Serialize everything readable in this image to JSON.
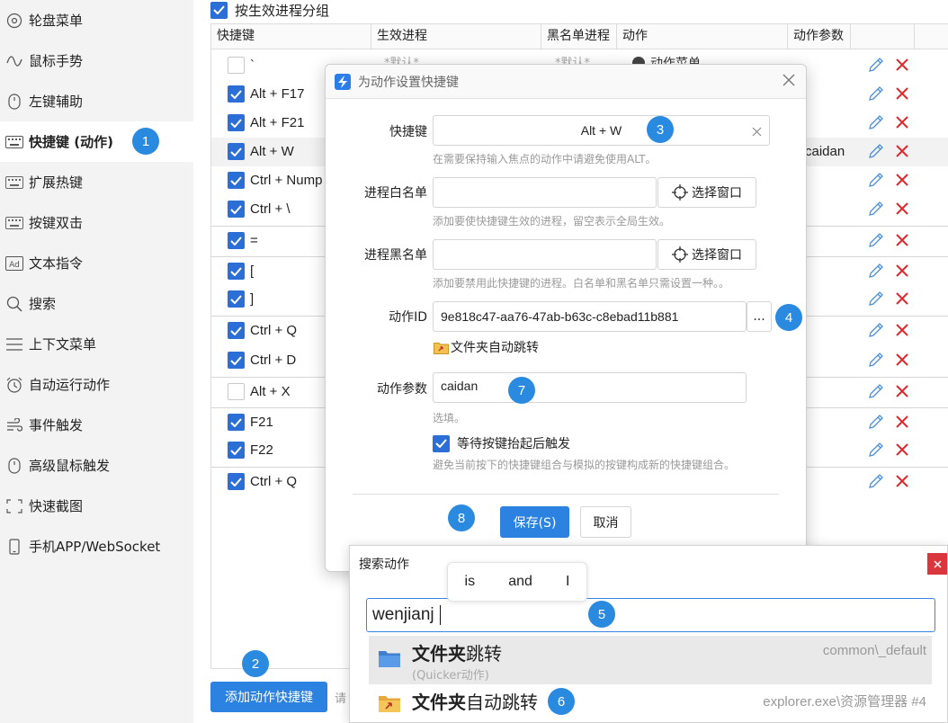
{
  "sidebar": {
    "items": [
      {
        "label": "轮盘菜单",
        "icon": "wheel-icon"
      },
      {
        "label": "鼠标手势",
        "icon": "gesture-icon"
      },
      {
        "label": "左键辅助",
        "icon": "mouse-icon"
      },
      {
        "label": "快捷键 (动作)",
        "icon": "keyboard-icon",
        "active": true
      },
      {
        "label": "扩展热键",
        "icon": "keyboard-icon"
      },
      {
        "label": "按键双击",
        "icon": "keyboard-icon"
      },
      {
        "label": "文本指令",
        "icon": "ad-icon"
      },
      {
        "label": "搜索",
        "icon": "search-icon"
      },
      {
        "label": "上下文菜单",
        "icon": "menu-icon"
      },
      {
        "label": "自动运行动作",
        "icon": "alarm-icon"
      },
      {
        "label": "事件触发",
        "icon": "wind-icon"
      },
      {
        "label": "高级鼠标触发",
        "icon": "mouse-icon"
      },
      {
        "label": "快速截图",
        "icon": "screenshot-icon"
      },
      {
        "label": "手机APP/WebSocket",
        "icon": "phone-icon"
      }
    ]
  },
  "main": {
    "group_by_label": "按生效进程分组",
    "columns": [
      "快捷键",
      "生效进程",
      "黑名单进程",
      "动作",
      "动作参数"
    ],
    "rows": [
      {
        "key": "`",
        "checked": false,
        "process": "*默认*",
        "blacklist": "*默认*",
        "action": "动作菜单"
      },
      {
        "key": "Alt + F17",
        "checked": true
      },
      {
        "key": "Alt + F21",
        "checked": true
      },
      {
        "key": "Alt + W",
        "checked": true,
        "params": "caidan",
        "selected": true
      },
      {
        "key": "Ctrl + Nump",
        "checked": true
      },
      {
        "key": "Ctrl + \\",
        "checked": true
      },
      {
        "key": "=",
        "checked": true
      },
      {
        "key": "[",
        "checked": true
      },
      {
        "key": "]",
        "checked": true
      },
      {
        "key": "Ctrl + Q",
        "checked": true
      },
      {
        "key": "Ctrl + D",
        "checked": true
      },
      {
        "key": "Alt + X",
        "checked": false
      },
      {
        "key": "F21",
        "checked": true
      },
      {
        "key": "F22",
        "checked": true
      },
      {
        "key": "Ctrl + Q",
        "checked": true
      }
    ],
    "add_button": "添加动作快捷键",
    "bottom_hint": "请"
  },
  "dialog": {
    "title": "为动作设置快捷键",
    "hotkey_label": "快捷键",
    "hotkey_value": "Alt + W",
    "hotkey_help": "在需要保持输入焦点的动作中请避免使用ALT。",
    "whitelist_label": "进程白名单",
    "whitelist_value": "",
    "whitelist_help": "添加要使快捷键生效的进程，留空表示全局生效。",
    "blacklist_label": "进程黑名单",
    "blacklist_value": "",
    "blacklist_help": "添加要禁用此快捷键的进程。白名单和黑名单只需设置一种。。",
    "pick_window": "选择窗口",
    "action_id_label": "动作ID",
    "action_id_value": "9e818c47-aa76-47ab-b63c-c8ebad11b881",
    "dots": "...",
    "action_name": "文件夹自动跳转",
    "params_label": "动作参数",
    "params_value": "caidan",
    "params_help": "选填。",
    "wait_release_label": "等待按键抬起后触发",
    "wait_release_help": "避免当前按下的快捷键组合与模拟的按键构成新的快捷键组合。",
    "save": "保存(S)",
    "cancel": "取消"
  },
  "search": {
    "title": "搜索动作",
    "ime_candidates": [
      "is",
      "and",
      "I"
    ],
    "query": "wenjianj",
    "results": [
      {
        "title_bold": "文件夹",
        "title_rest": "跳转",
        "sub": "(Quicker动作)",
        "right": "common\\_default"
      },
      {
        "title_bold": "文件夹",
        "title_rest": "自动跳转",
        "sub": "",
        "right": "explorer.exe\\资源管理器 #4"
      }
    ]
  },
  "badges": [
    "1",
    "2",
    "3",
    "4",
    "5",
    "6",
    "7",
    "8"
  ],
  "colors": {
    "accent": "#2c82e0",
    "badge": "#2a8ae0",
    "delete": "#e0282e",
    "close": "#d9363e"
  }
}
